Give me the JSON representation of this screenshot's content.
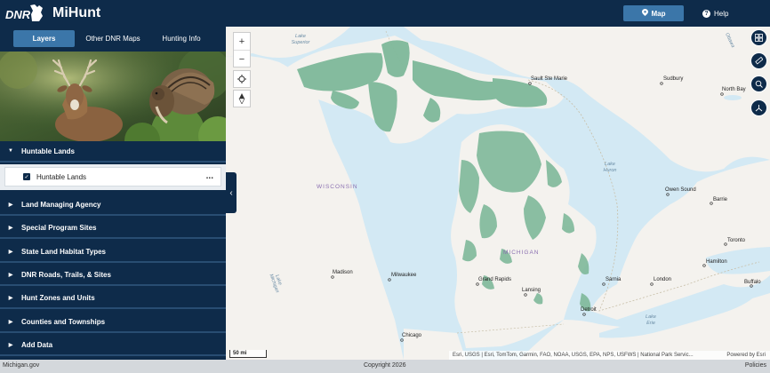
{
  "header": {
    "logo_text": "DNR",
    "app_title": "MiHunt",
    "map_button": "Map",
    "help_button": "Help"
  },
  "tabs": [
    {
      "label": "Layers",
      "active": true
    },
    {
      "label": "Other DNR Maps",
      "active": false
    },
    {
      "label": "Hunting Info",
      "active": false
    }
  ],
  "sections": [
    {
      "label": "Huntable Lands",
      "expanded": true
    },
    {
      "label": "Land Managing Agency",
      "expanded": false
    },
    {
      "label": "Special Program Sites",
      "expanded": false
    },
    {
      "label": "State Land Habitat Types",
      "expanded": false
    },
    {
      "label": "DNR Roads, Trails, & Sites",
      "expanded": false
    },
    {
      "label": "Hunt Zones and Units",
      "expanded": false
    },
    {
      "label": "Counties and Townships",
      "expanded": false
    },
    {
      "label": "Add Data",
      "expanded": false
    }
  ],
  "layer_item": {
    "label": "Huntable Lands",
    "checked": true,
    "menu": "..."
  },
  "map": {
    "labels": {
      "lake_superior": "Lake\nSuperior",
      "wisconsin": "WISCONSIN",
      "michigan": "MICHIGAN",
      "lake_michigan": "Lake\nMichigan",
      "lake_huron": "Lake\nHuron",
      "lake_erie": "Lake\nErie",
      "ottawa": "Ottawa"
    },
    "cities": [
      {
        "name": "Sault Ste Marie"
      },
      {
        "name": "Sudbury"
      },
      {
        "name": "North Bay"
      },
      {
        "name": "Owen Sound"
      },
      {
        "name": "Barrie"
      },
      {
        "name": "Toronto"
      },
      {
        "name": "Hamilton"
      },
      {
        "name": "Buffalo"
      },
      {
        "name": "London"
      },
      {
        "name": "Sarnia"
      },
      {
        "name": "Detroit"
      },
      {
        "name": "Lansing"
      },
      {
        "name": "Grand Rapids"
      },
      {
        "name": "Milwaukee"
      },
      {
        "name": "Madison"
      },
      {
        "name": "Chicago"
      }
    ],
    "scale_label": "50 mi",
    "attribution": "Esri, USGS | Esri, TomTom, Garmin, FAO, NOAA, USGS, EPA, NPS, USFWS | National Park Servic...",
    "powered_by": "Powered by Esri"
  },
  "footer": {
    "left": "Michigan.gov",
    "center": "Copyright 2026",
    "right": "Policies"
  },
  "colors": {
    "navy": "#0e2b4a",
    "accent_blue": "#3b76a9",
    "water": "#d3e9f4",
    "land": "#f4f2ee",
    "public_land_green": "#7fb99a"
  }
}
